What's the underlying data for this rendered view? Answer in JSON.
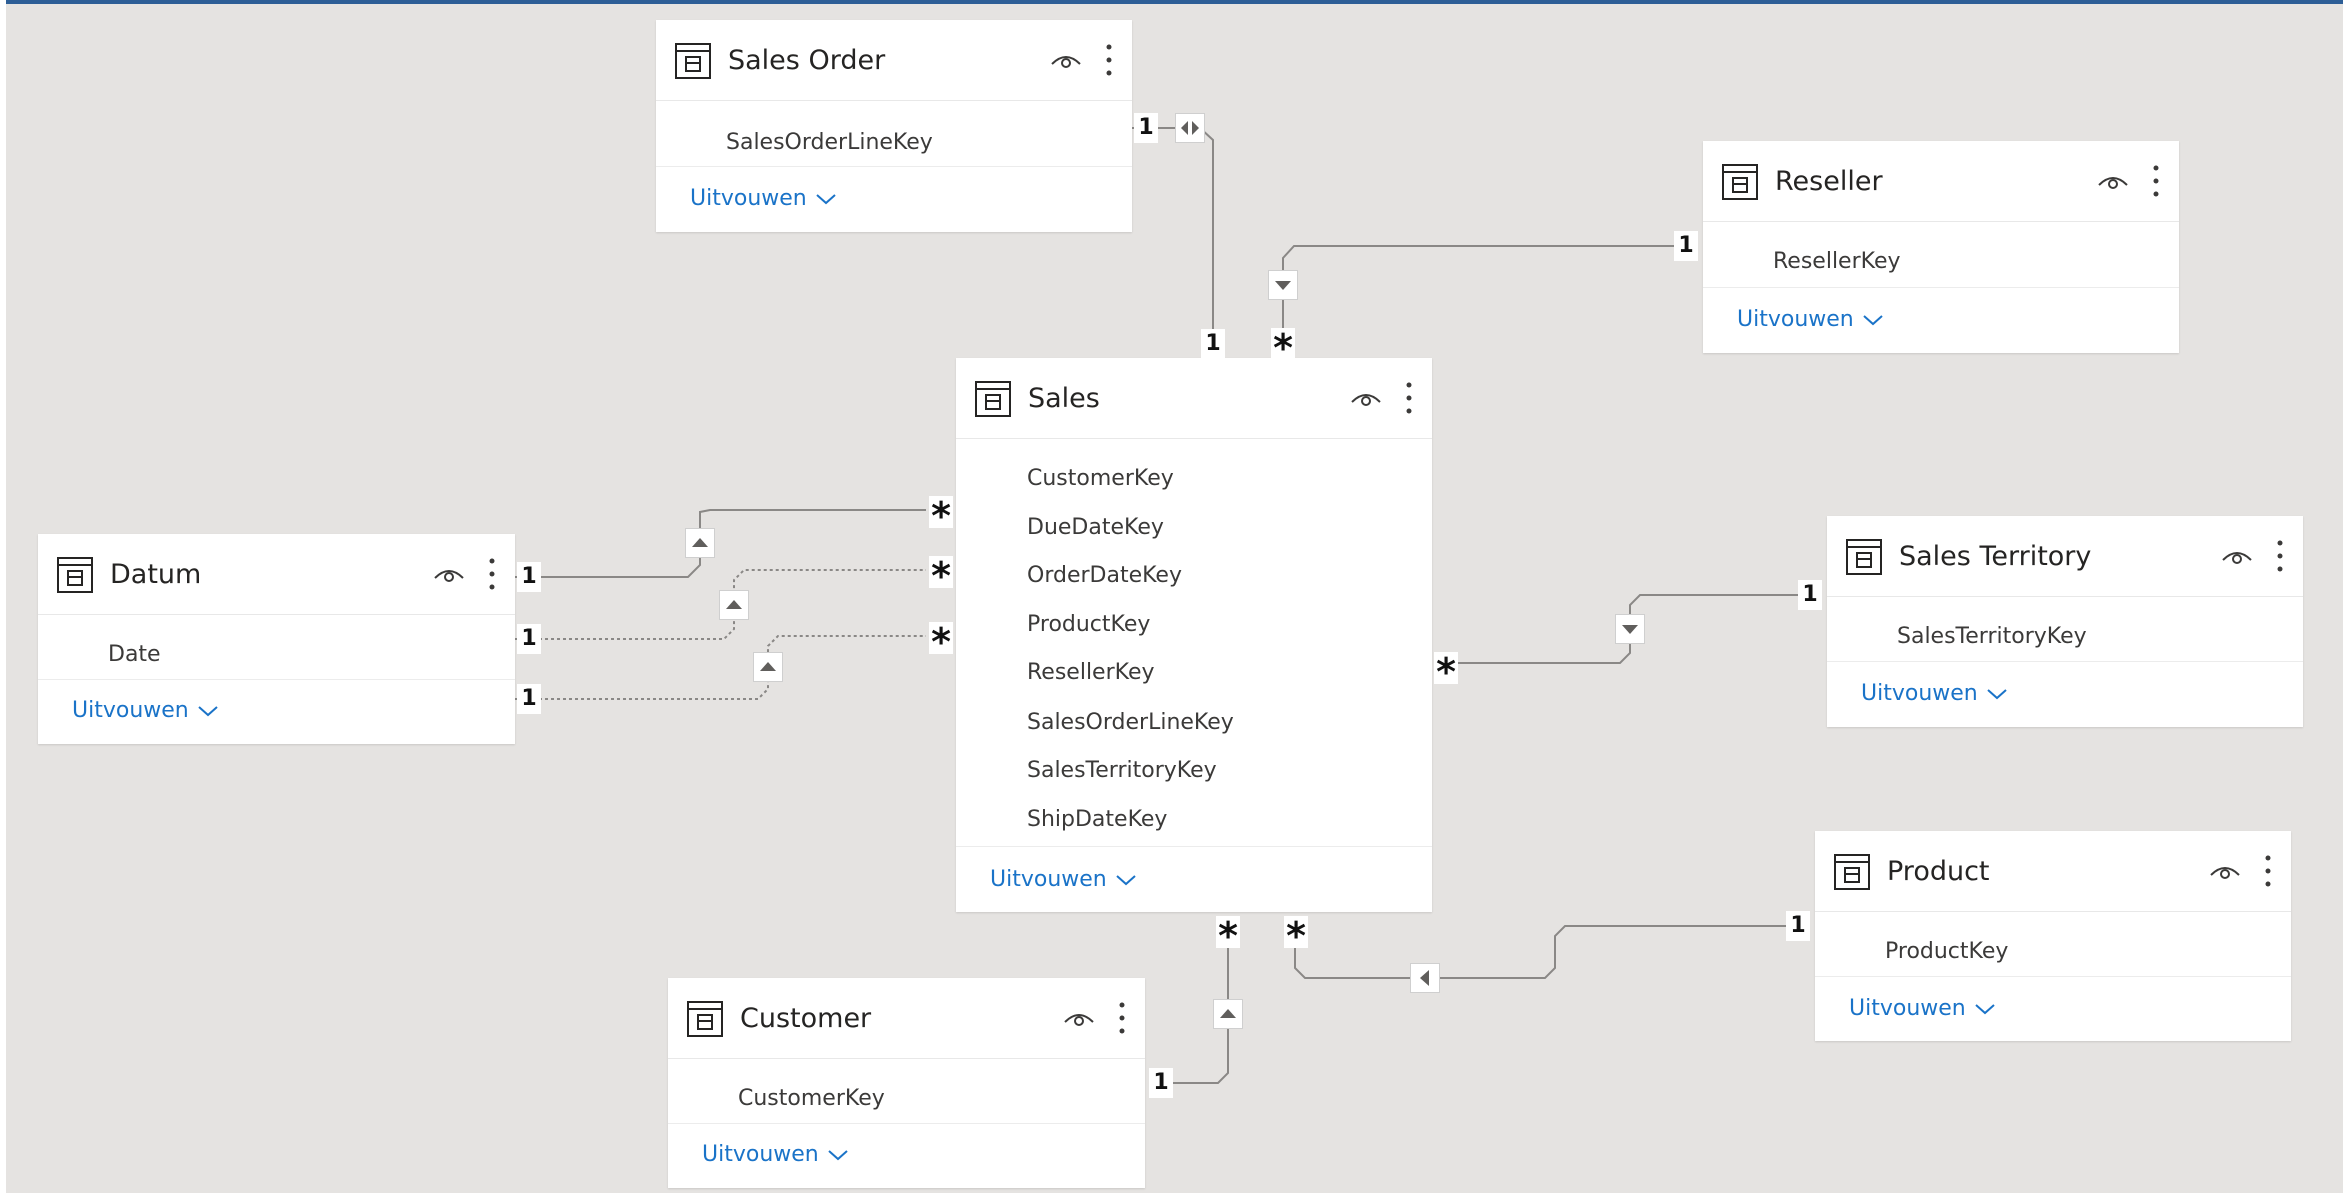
{
  "colors": {
    "canvas": "#e5e3e1",
    "card": "#ffffff",
    "title_text": "#252423",
    "field_text": "#3b3a39",
    "link": "#1a73c8",
    "line": "#8a8886",
    "top_border": "#2d5e96"
  },
  "icons": {
    "table": "table-icon",
    "visibility": "eye-icon",
    "more": "more-options-icon",
    "expand": "chevron-down-icon",
    "filter_direction": "triangle-arrow-icon"
  },
  "tables": {
    "sales_order": {
      "title": "Sales Order",
      "fields": [
        "SalesOrderLineKey"
      ],
      "expand_label": "Uitvouwen"
    },
    "reseller": {
      "title": "Reseller",
      "fields": [
        "ResellerKey"
      ],
      "expand_label": "Uitvouwen"
    },
    "sales": {
      "title": "Sales",
      "fields": [
        "CustomerKey",
        "DueDateKey",
        "OrderDateKey",
        "ProductKey",
        "ResellerKey",
        "SalesOrderLineKey",
        "SalesTerritoryKey",
        "ShipDateKey"
      ],
      "expand_label": "Uitvouwen"
    },
    "datum": {
      "title": "Datum",
      "fields": [
        "Date"
      ],
      "expand_label": "Uitvouwen"
    },
    "sales_territory": {
      "title": "Sales Territory",
      "fields": [
        "SalesTerritoryKey"
      ],
      "expand_label": "Uitvouwen"
    },
    "product": {
      "title": "Product",
      "fields": [
        "ProductKey"
      ],
      "expand_label": "Uitvouwen"
    },
    "customer": {
      "title": "Customer",
      "fields": [
        "CustomerKey"
      ],
      "expand_label": "Uitvouwen"
    }
  },
  "cardinality": {
    "one": "1",
    "many": "*"
  },
  "relationships": [
    {
      "from": "Sales Order",
      "to": "Sales",
      "from_card": "1",
      "to_card": "1",
      "filter": "both",
      "active": true
    },
    {
      "from": "Reseller",
      "to": "Sales",
      "from_card": "1",
      "to_card": "*",
      "filter": "single",
      "active": true
    },
    {
      "from": "Datum",
      "to": "Sales",
      "from_card": "1",
      "to_card": "*",
      "filter": "single",
      "active": true
    },
    {
      "from": "Datum",
      "to": "Sales",
      "from_card": "1",
      "to_card": "*",
      "filter": "single",
      "active": false
    },
    {
      "from": "Datum",
      "to": "Sales",
      "from_card": "1",
      "to_card": "*",
      "filter": "single",
      "active": false
    },
    {
      "from": "Sales Territory",
      "to": "Sales",
      "from_card": "1",
      "to_card": "*",
      "filter": "single",
      "active": true
    },
    {
      "from": "Product",
      "to": "Sales",
      "from_card": "1",
      "to_card": "*",
      "filter": "single",
      "active": true
    },
    {
      "from": "Customer",
      "to": "Sales",
      "from_card": "1",
      "to_card": "*",
      "filter": "single",
      "active": true
    }
  ]
}
